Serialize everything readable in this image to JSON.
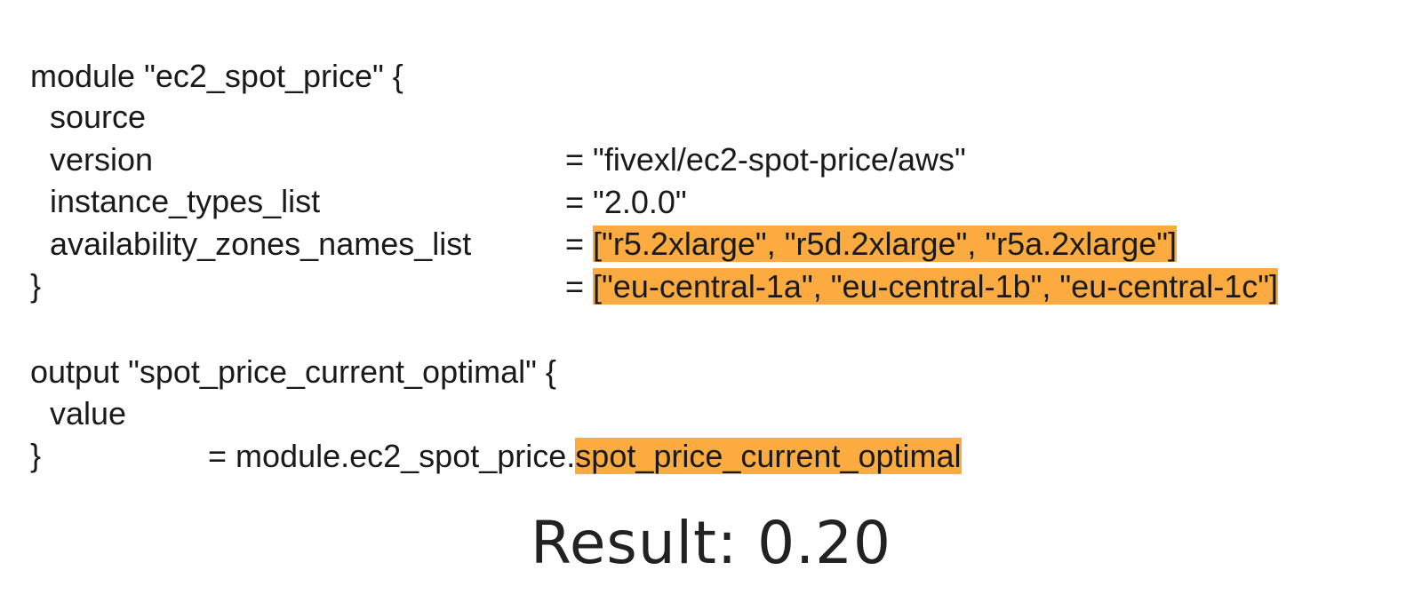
{
  "colors": {
    "highlight": "#fbab3f",
    "text": "#1a1a1a",
    "background": "#ffffff"
  },
  "module_block": {
    "header": "module \"ec2_spot_price\" {",
    "lines": [
      {
        "key": "source",
        "eq": "=",
        "value": "\"fivexl/ec2-spot-price/aws\"",
        "highlighted": false
      },
      {
        "key": "version",
        "eq": "=",
        "value": "\"2.0.0\"",
        "highlighted": false
      },
      {
        "key": "instance_types_list",
        "eq": "=",
        "value": "[\"r5.2xlarge\", \"r5d.2xlarge\", \"r5a.2xlarge\"]",
        "highlighted": true
      },
      {
        "key": "availability_zones_names_list",
        "eq": "=",
        "value": "[\"eu-central-1a\", \"eu-central-1b\", \"eu-central-1c\"]",
        "highlighted": true
      }
    ],
    "closer": "}"
  },
  "output_block": {
    "header": "output \"spot_price_current_optimal\" {",
    "line": {
      "key": "value",
      "eq": "=",
      "value_prefix": "module.ec2_spot_price.",
      "value_highlighted": "spot_price_current_optimal"
    },
    "closer": "}"
  },
  "result": {
    "label": "Result:",
    "value": "0.20"
  }
}
